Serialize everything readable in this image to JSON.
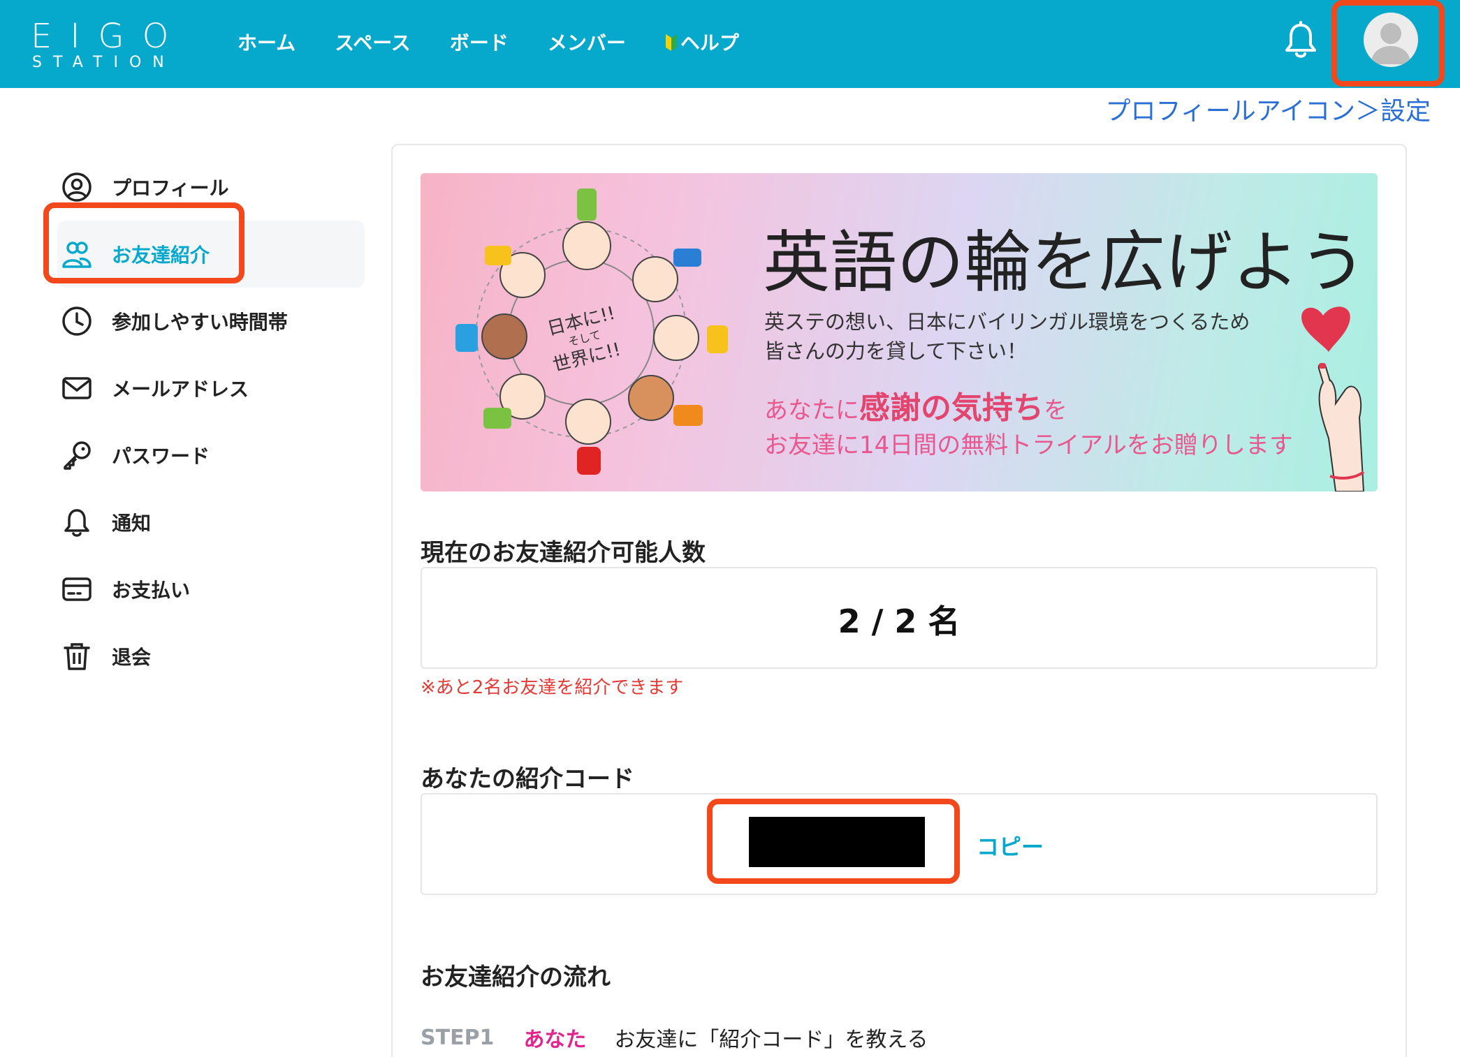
{
  "header": {
    "logo_main": "EIGO",
    "logo_sub": "STATION",
    "nav": [
      "ホーム",
      "スペース",
      "ボード",
      "メンバー",
      "ヘルプ"
    ]
  },
  "caption": "プロフィールアイコン＞設定",
  "sidebar": {
    "items": [
      {
        "label": "プロフィール",
        "icon": "user-circle-icon",
        "active": false
      },
      {
        "label": "お友達紹介",
        "icon": "users-icon",
        "active": true
      },
      {
        "label": "参加しやすい時間帯",
        "icon": "clock-icon",
        "active": false
      },
      {
        "label": "メールアドレス",
        "icon": "mail-icon",
        "active": false
      },
      {
        "label": "パスワード",
        "icon": "key-icon",
        "active": false
      },
      {
        "label": "通知",
        "icon": "bell-icon",
        "active": false
      },
      {
        "label": "お支払い",
        "icon": "credit-card-icon",
        "active": false
      },
      {
        "label": "退会",
        "icon": "trash-icon",
        "active": false
      }
    ]
  },
  "banner": {
    "title": "英語の輪を広げよう",
    "sub_line1": "英ステの想い、日本にバイリンガル環境をつくるため",
    "sub_line2": "皆さんの力を貸して下さい！",
    "pink_pre": "あなたに",
    "pink_em": "感謝の気持ち",
    "pink_post": "を",
    "pink_line2": "お友達に14日間の無料トライアルをお贈りします",
    "circle_text1": "日本に!!",
    "circle_text2": "そして",
    "circle_text3": "世界に!!"
  },
  "referral_count": {
    "title": "現在のお友達紹介可能人数",
    "value": "2 / 2 名",
    "note": "※あと2名お友達を紹介できます"
  },
  "referral_code": {
    "title": "あなたの紹介コード",
    "copy_label": "コピー"
  },
  "flow": {
    "title": "お友達紹介の流れ",
    "steps": [
      {
        "no": "STEP1",
        "who": "あなた",
        "text": "お友達に「紹介コード」を教える"
      }
    ]
  },
  "colors": {
    "header_bg": "#06a8cb",
    "accent": "#06a8cb",
    "highlight": "#f2481c",
    "note_red": "#e53935",
    "pink": "#e2258c"
  }
}
